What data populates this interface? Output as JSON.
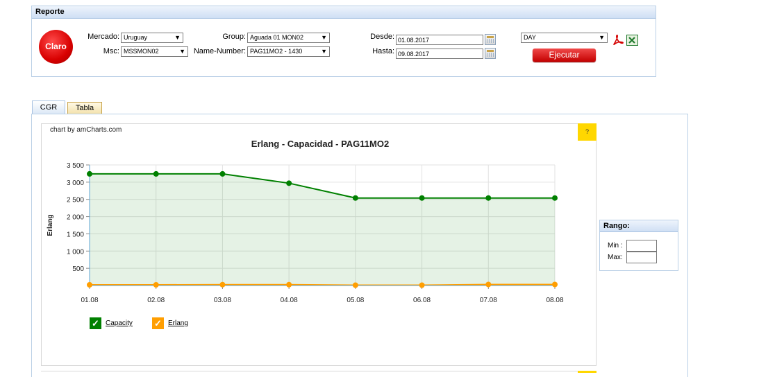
{
  "reporte": {
    "title": "Reporte",
    "logo_text": "Claro",
    "mercado": {
      "label": "Mercado:",
      "value": "Uruguay"
    },
    "msc": {
      "label": "Msc:",
      "value": "MSSMON02"
    },
    "group": {
      "label": "Group:",
      "value": "Aguada 01 MON02"
    },
    "name_number": {
      "label": "Name-Number:",
      "value": "PAG11MO2 - 1430"
    },
    "desde": {
      "label": "Desde:",
      "value": "01.08.2017"
    },
    "hasta": {
      "label": "Hasta:",
      "value": "09.08.2017"
    },
    "granularity": {
      "value": "DAY"
    },
    "execute_label": "Ejecutar",
    "icons": {
      "pdf": "pdf-export-icon",
      "excel": "excel-export-icon",
      "calendar": "calendar-icon"
    }
  },
  "tabs": [
    {
      "label": "CGR",
      "active": true
    },
    {
      "label": "Tabla",
      "active": false
    }
  ],
  "chart": {
    "credit": "chart by amCharts.com",
    "help": "?"
  },
  "chart_data": {
    "type": "area",
    "title": "Erlang - Capacidad - PAG11MO2",
    "xlabel": "",
    "ylabel": "Erlang",
    "ylim": [
      0,
      3500
    ],
    "y_ticks": [
      500,
      1000,
      1500,
      2000,
      2500,
      3000,
      3500
    ],
    "y_tick_labels": [
      "500",
      "1 000",
      "1 500",
      "2 000",
      "2 500",
      "3 000",
      "3 500"
    ],
    "categories": [
      "01.08",
      "02.08",
      "03.08",
      "04.08",
      "05.08",
      "06.08",
      "07.08",
      "08.08"
    ],
    "series": [
      {
        "name": "Capacity",
        "color": "#008000",
        "fill": true,
        "values": [
          3240,
          3240,
          3240,
          2970,
          2540,
          2540,
          2540,
          2540
        ]
      },
      {
        "name": "Erlang",
        "color": "#ff9e01",
        "fill": false,
        "values": [
          20,
          20,
          25,
          25,
          10,
          10,
          30,
          30
        ]
      }
    ],
    "grid": true,
    "legend": "bottom-left"
  },
  "rango": {
    "title": "Rango:",
    "min_label": "Min :",
    "max_label": "Max:",
    "min_value": "",
    "max_value": ""
  }
}
